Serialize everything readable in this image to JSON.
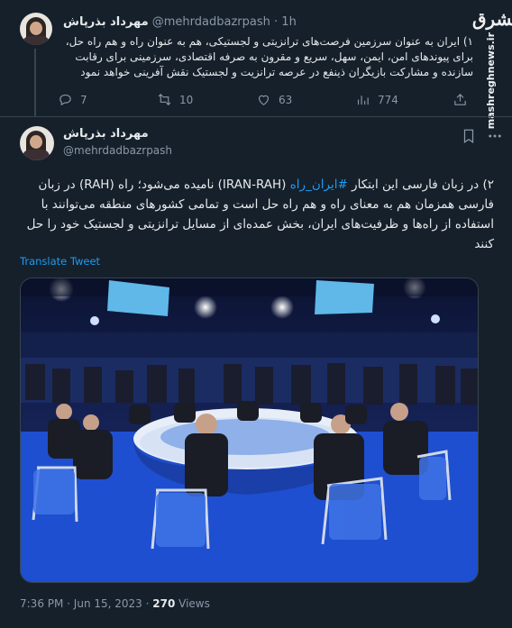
{
  "watermark": {
    "logo": "مشرق",
    "site": "mashreghnews.ir"
  },
  "tweet1": {
    "author_name": "مهرداد بذرپاش",
    "handle": "@mehrdadbazrpash",
    "separator": "·",
    "time": "1h",
    "text": "۱) ایران به عنوان سرزمین فرصت‌های ترانزیتی و لجستیکی، هم به عنوان راه و هم راه حل، برای پیوندهای امن، ایمن، سهل، سریع و مقرون به صرفه اقتصادی، سرزمینی برای رقابت سازنده و مشارکت بازیگران ذینفع در عرصه ترانزیت و لجستیک نقش آفرینی خواهد نمود",
    "replies": "7",
    "retweets": "10",
    "likes": "63",
    "views": "774"
  },
  "tweet2": {
    "author_name": "مهرداد بذرپاش",
    "handle": "@mehrdadbazrpash",
    "text_before": "۲) در زبان فارسی این ابتکار ",
    "hashtag": "#ایران_راه",
    "text_after": " (IRAN-RAH) نامیده می‌شود؛ راه (RAH) در زبان فارسی همزمان هم به معنای راه و هم راه حل است و تمامی کشورهای منطقه می‌توانند با استفاده از راه‌ها و ظرفیت‌های ایران، بخش عمده‌ای از مسایل ترانزیتی و لجستیک خود را حل کنند",
    "translate_label": "Translate Tweet",
    "timestamp": "7:36 PM · Jun 15, 2023 · ",
    "views_count": "270",
    "views_label": " Views"
  },
  "icons": [
    "reply-icon",
    "retweet-icon",
    "like-icon",
    "views-icon",
    "share-icon",
    "bookmark-icon",
    "more-icon"
  ],
  "colors": {
    "background": "#15202b",
    "text": "#e7e9ea",
    "muted": "#8b98a5",
    "link": "#1d9bf0",
    "divider": "#38444d"
  }
}
